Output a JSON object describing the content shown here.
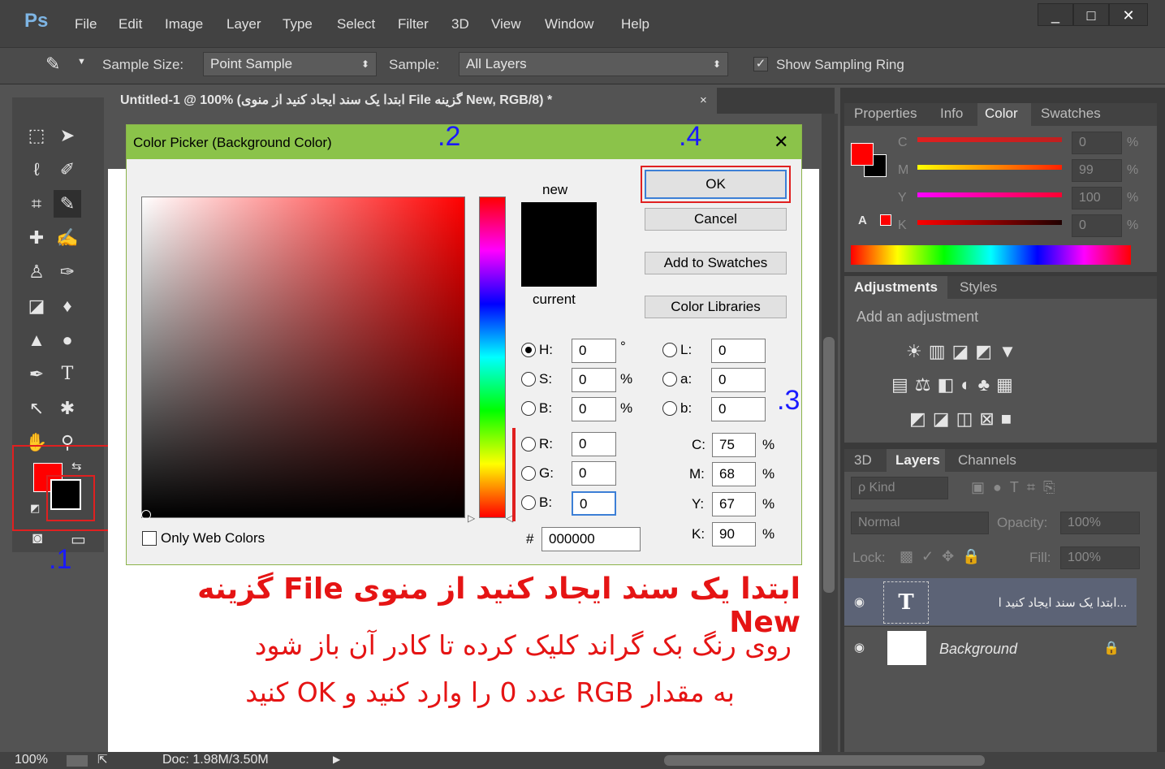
{
  "app": {
    "logo": "Ps"
  },
  "menu": [
    "File",
    "Edit",
    "Image",
    "Layer",
    "Type",
    "Select",
    "Filter",
    "3D",
    "View",
    "Window",
    "Help"
  ],
  "window_controls": {
    "minimize": "_",
    "maximize": "□",
    "close": "✕"
  },
  "options": {
    "sample_size_label": "Sample Size:",
    "sample_size_value": "Point Sample",
    "sample_label": "Sample:",
    "sample_value": "All Layers",
    "ring_label": "Show Sampling Ring"
  },
  "document": {
    "tab_title": "Untitled-1 @ 100% (ابتدا یک سند ایجاد کنید  از منوی File  گزینه New, RGB/8) *",
    "tab_close": "×"
  },
  "dialog": {
    "title": "Color Picker (Background Color)",
    "close": "✕",
    "new_label": "new",
    "current_label": "current",
    "ok": "OK",
    "cancel": "Cancel",
    "add_swatches": "Add to Swatches",
    "color_libraries": "Color Libraries",
    "only_web": "Only Web Colors",
    "hsb": [
      {
        "label": "H:",
        "value": "0",
        "unit": "°"
      },
      {
        "label": "S:",
        "value": "0",
        "unit": "%"
      },
      {
        "label": "B:",
        "value": "0",
        "unit": "%"
      }
    ],
    "lab": [
      {
        "label": "L:",
        "value": "0"
      },
      {
        "label": "a:",
        "value": "0"
      },
      {
        "label": "b:",
        "value": "0"
      }
    ],
    "rgb": [
      {
        "label": "R:",
        "value": "0"
      },
      {
        "label": "G:",
        "value": "0"
      },
      {
        "label": "B:",
        "value": "0"
      }
    ],
    "cmyk": [
      {
        "label": "C:",
        "value": "75",
        "unit": "%"
      },
      {
        "label": "M:",
        "value": "68",
        "unit": "%"
      },
      {
        "label": "Y:",
        "value": "67",
        "unit": "%"
      },
      {
        "label": "K:",
        "value": "90",
        "unit": "%"
      }
    ],
    "hex_label": "#",
    "hex_value": "000000"
  },
  "annotations": {
    "n1": ".1",
    "n2": ".2",
    "n3": ".3",
    "n4": ".4"
  },
  "instructions": {
    "line1": "ابتدا یک سند ایجاد کنید  از منوی File  گزینه New",
    "line2": "روی رنگ بک گراند کلیک کرده تا کادر آن باز شود",
    "line3": "به مقدار RGB عدد 0 را وارد کنید و OK کنید"
  },
  "color_panel": {
    "tabs": [
      "Properties",
      "Info",
      "Color",
      "Swatches"
    ],
    "rows": [
      {
        "label": "C",
        "value": "0",
        "unit": "%"
      },
      {
        "label": "M",
        "value": "99",
        "unit": "%"
      },
      {
        "label": "Y",
        "value": "100",
        "unit": "%"
      },
      {
        "label": "K",
        "value": "0",
        "unit": "%"
      }
    ]
  },
  "adjustments": {
    "tabs": [
      "Adjustments",
      "Styles"
    ],
    "hint": "Add an adjustment"
  },
  "layers": {
    "tabs": [
      "3D",
      "Layers",
      "Channels"
    ],
    "kind": "ρ Kind",
    "blend": "Normal",
    "opacity_label": "Opacity:",
    "opacity_value": "100%",
    "lock_label": "Lock:",
    "fill_label": "Fill:",
    "fill_value": "100%",
    "items": [
      {
        "name": "...ابتدا یک سند ایجاد کنید  ا"
      },
      {
        "name": "Background"
      }
    ]
  },
  "status": {
    "zoom": "100%",
    "doc": "Doc: 1.98M/3.50M"
  }
}
